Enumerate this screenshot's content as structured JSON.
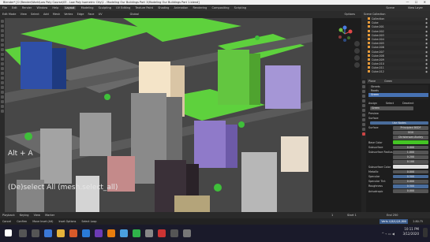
{
  "window": {
    "title": "Blender* [C:\\Render\\Work\\Low Poly Course\\03 - Low Poly Isometric City\\1 - Modeling Our Buildings Part 1\\Modeling Our Buildings Part 1.blend]",
    "controls": "—  ☐  ✕"
  },
  "menubar": {
    "items": [
      "File",
      "Edit",
      "Render",
      "Window",
      "Help"
    ],
    "workspaces": [
      "Layout",
      "Modeling",
      "Sculpting",
      "UV Editing",
      "Texture Paint",
      "Shading",
      "Animation",
      "Rendering",
      "Compositing",
      "Scripting"
    ],
    "active_workspace": "Layout",
    "scene": "Scene",
    "view_layer": "View Layer"
  },
  "viewport_header": {
    "mode": "Edit Mode",
    "items": [
      "View",
      "Select",
      "Add",
      "Mesh",
      "Vertex",
      "Edge",
      "Face",
      "UV"
    ],
    "transform": "Global",
    "options": "Options"
  },
  "viewport": {
    "key_overlay": "Alt + A",
    "operator_overlay": "(De)select All (mesh.select_all)",
    "gizmo_axes": [
      "X",
      "Y",
      "Z"
    ]
  },
  "outliner": {
    "header": "Scene Collection",
    "items": [
      "Collection",
      "Cube",
      "Cube.001",
      "Cube.002",
      "Cube.003",
      "Cube.004",
      "Cube.005",
      "Cube.006",
      "Cube.007",
      "Cube.008",
      "Cube.009",
      "Cube.010",
      "Cube.011",
      "Cube.012"
    ]
  },
  "properties": {
    "header": "Plane",
    "object_label": "Green",
    "material_slots": [
      "Streets",
      "Roads",
      "Green"
    ],
    "selected_slot": "Green",
    "slot_buttons": [
      "Assign",
      "Select",
      "Deselect"
    ],
    "material_name": "Green",
    "sections": [
      "Preview",
      "Surface"
    ],
    "use_nodes": "Use Nodes",
    "surface_label": "Surface",
    "surface_value": "Principled BSDF",
    "fields": [
      {
        "label": "",
        "value": "GGX"
      },
      {
        "label": "",
        "value": "Christensen-Burley"
      },
      {
        "label": "Base Color",
        "value": ""
      },
      {
        "label": "Subsurface",
        "value": "0.000"
      },
      {
        "label": "Subsurface Radius",
        "value": "1.000"
      },
      {
        "label": "",
        "value": "0.200"
      },
      {
        "label": "",
        "value": "0.100"
      },
      {
        "label": "Subsurface Color",
        "value": ""
      },
      {
        "label": "Metallic",
        "value": "0.000"
      },
      {
        "label": "Specular",
        "value": "0.500"
      },
      {
        "label": "Specular Tint",
        "value": "0.000"
      },
      {
        "label": "Roughness",
        "value": "0.500"
      },
      {
        "label": "Anisotropic",
        "value": "0.000"
      }
    ],
    "base_color": "#45c425"
  },
  "timeline": {
    "items": [
      "Playback",
      "Keying",
      "View",
      "Marker"
    ],
    "frame": "1",
    "start": "Start 1",
    "end": "End 250"
  },
  "statusbar": {
    "items": [
      "Cancel",
      "Confirm",
      "Move Inset (Alt)",
      "Inset Options",
      "Select Loop"
    ],
    "badge": "Verts 4,8/4,0/4,800",
    "version": "2.80.75"
  },
  "taskbar": {
    "time": "10:11 PM",
    "date": "3/12/2020",
    "tray": "^ ⌁ ▭ ◀"
  },
  "colors": {
    "accent": "#4772b3",
    "grass": "#5ed13d",
    "road": "#6a6a6a",
    "selected_orange": "#e69a3a"
  }
}
